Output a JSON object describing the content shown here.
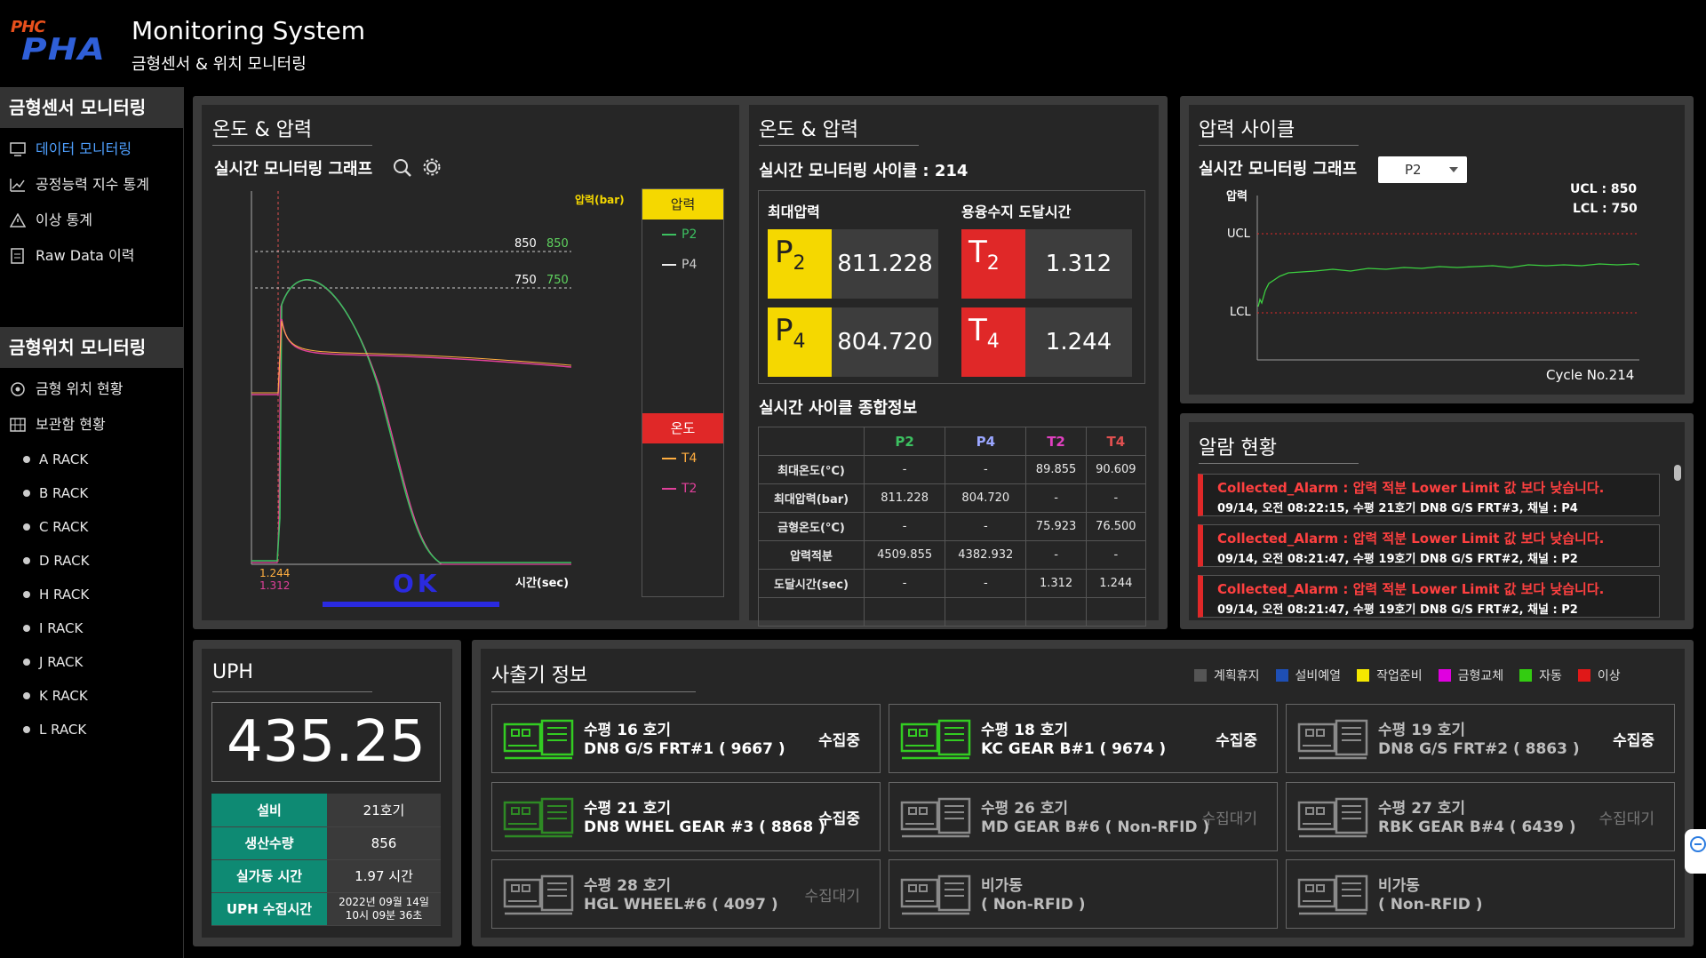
{
  "header": {
    "logo_top": "PHC",
    "logo_main": "PHA",
    "title": "Monitoring System",
    "subtitle": "금형센서 & 위치 모니터링"
  },
  "sidebar": {
    "section1": "금형센서 모니터링",
    "items1": [
      {
        "label": "데이터 모니터링",
        "icon": "monitor-icon"
      },
      {
        "label": "공정능력 지수 통계",
        "icon": "chart-icon"
      },
      {
        "label": "이상 통계",
        "icon": "warning-icon"
      },
      {
        "label": "Raw Data 이력",
        "icon": "file-icon"
      }
    ],
    "section2": "금형위치 모니터링",
    "items2": [
      {
        "label": "금형 위치 현황",
        "icon": "location-icon"
      },
      {
        "label": "보관함 현황",
        "icon": "grid-icon"
      }
    ],
    "racks": [
      "A RACK",
      "B RACK",
      "C RACK",
      "D RACK",
      "H RACK",
      "I RACK",
      "J RACK",
      "K RACK",
      "L RACK"
    ]
  },
  "graph_panel": {
    "title": "온도 & 압력",
    "subtitle": "실시간 모니터링 그래프",
    "y_label": "압력(bar)",
    "x_label": "시간(sec)",
    "ucl_left": "850",
    "ucl_right": "850",
    "lcl_left": "750",
    "lcl_right": "750",
    "t_val1": "1.244",
    "t_val2": "1.312",
    "ok": "OK",
    "legend_pressure": "압력",
    "legend_temp": "온도",
    "p_items": [
      "P2",
      "P4"
    ],
    "t_items": [
      "T4",
      "T2"
    ]
  },
  "value_panel": {
    "title": "온도 & 압력",
    "cycle_label": "실시간 모니터링 사이클 : 214",
    "max_pressure": "최대압력",
    "reach_time": "용융수지 도달시간",
    "p2": {
      "tag": "P",
      "sub": "2",
      "value": "811.228"
    },
    "p4": {
      "tag": "P",
      "sub": "4",
      "value": "804.720"
    },
    "t2": {
      "tag": "T",
      "sub": "2",
      "value": "1.312"
    },
    "t4": {
      "tag": "T",
      "sub": "4",
      "value": "1.244"
    },
    "summary_title": "실시간 사이클 종합정보",
    "table": {
      "headers": [
        "",
        "P2",
        "P4",
        "T2",
        "T4"
      ],
      "rows": [
        [
          "최대온도(°C)",
          "-",
          "-",
          "89.855",
          "90.609"
        ],
        [
          "최대압력(bar)",
          "811.228",
          "804.720",
          "-",
          "-"
        ],
        [
          "금형온도(°C)",
          "-",
          "-",
          "75.923",
          "76.500"
        ],
        [
          "압력적분",
          "4509.855",
          "4382.932",
          "-",
          "-"
        ],
        [
          "도달시간(sec)",
          "-",
          "-",
          "1.312",
          "1.244"
        ]
      ]
    }
  },
  "cycle_panel": {
    "title": "압력 사이클",
    "subtitle": "실시간 모니터링 그래프",
    "select": "P2",
    "y_label": "압력",
    "ucl": "UCL",
    "lcl": "LCL",
    "ucl_val": "UCL : 850",
    "lcl_val": "LCL : 750",
    "cycle_no": "Cycle No.214"
  },
  "alarm_panel": {
    "title": "알람 현황",
    "alarms": [
      {
        "line1": "Collected_Alarm : 압력 적분 Lower Limit 값 보다 낮습니다.",
        "line2": "09/14, 오전 08:22:15, 수평 21호기 DN8 G/S FRT#3, 채널 : P4"
      },
      {
        "line1": "Collected_Alarm : 압력 적분 Lower Limit 값 보다 낮습니다.",
        "line2": "09/14, 오전 08:21:47, 수평 19호기 DN8 G/S FRT#2, 채널 : P2"
      },
      {
        "line1": "Collected_Alarm : 압력 적분 Lower Limit 값 보다 낮습니다.",
        "line2": "09/14, 오전 08:21:47, 수평 19호기 DN8 G/S FRT#2, 채널 : P2"
      }
    ]
  },
  "uph_panel": {
    "title": "UPH",
    "value": "435.25",
    "rows": [
      [
        "설비",
        "21호기"
      ],
      [
        "생산수량",
        "856"
      ],
      [
        "실가동 시간",
        "1.97 시간"
      ],
      [
        "UPH 수집시간",
        "2022년 09월 14일\n10시 09분 36초"
      ]
    ]
  },
  "machine_panel": {
    "title": "사출기 정보",
    "legend": [
      {
        "label": "계획휴지",
        "color": "#555555"
      },
      {
        "label": "설비예열",
        "color": "#1e4fb5"
      },
      {
        "label": "작업준비",
        "color": "#f5e800"
      },
      {
        "label": "금형교체",
        "color": "#e000e0"
      },
      {
        "label": "자동",
        "color": "#33cc11"
      },
      {
        "label": "이상",
        "color": "#e01818"
      }
    ],
    "machines": [
      {
        "line1": "수평 16 호기",
        "line2": "DN8 G/S FRT#1 ( 9667 )",
        "status": "수집중",
        "state": "active"
      },
      {
        "line1": "수평 18 호기",
        "line2": "KC GEAR B#1 ( 9674 )",
        "status": "수집중",
        "state": "active"
      },
      {
        "line1": "수평 19 호기",
        "line2": "DN8 G/S FRT#2 ( 8863 )",
        "status": "수집중",
        "state": "off"
      },
      {
        "line1": "수평 21 호기",
        "line2": "DN8 WHEL GEAR #3 ( 8868 )",
        "status": "수집중",
        "state": "dimgreen"
      },
      {
        "line1": "수평 26 호기",
        "line2": "MD GEAR B#6 ( Non-RFID )",
        "status": "수집대기",
        "state": "off"
      },
      {
        "line1": "수평 27 호기",
        "line2": "RBK GEAR B#4 ( 6439 )",
        "status": "수집대기",
        "state": "off"
      },
      {
        "line1": "수평 28 호기",
        "line2": "HGL WHEEL#6 ( 4097 )",
        "status": "수집대기",
        "state": "off"
      },
      {
        "line1": "비가동",
        "line2": "( Non-RFID )",
        "status": "",
        "state": "off"
      },
      {
        "line1": "비가동",
        "line2": "( Non-RFID )",
        "status": "",
        "state": "off"
      }
    ]
  },
  "colors": {
    "accent_blue": "#4fa0ff",
    "yellow": "#f5d800",
    "red": "#e02828",
    "green": "#33cc33",
    "pink": "#e0409a"
  }
}
